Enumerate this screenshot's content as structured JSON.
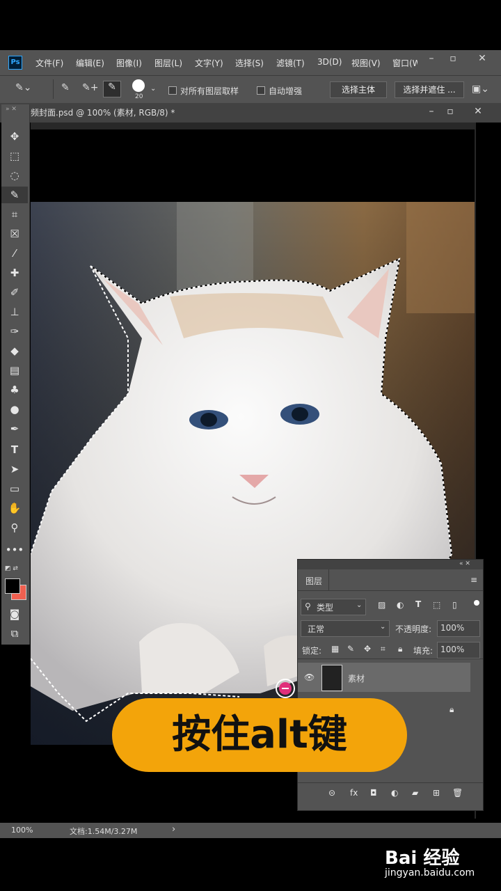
{
  "app": {
    "logo": "Ps"
  },
  "menu": [
    "文件(F)",
    "编辑(E)",
    "图像(I)",
    "图层(L)",
    "文字(Y)",
    "选择(S)",
    "滤镜(T)",
    "3D(D)",
    "视图(V)",
    "窗口(W"
  ],
  "options": {
    "brush_size": "20",
    "sample_all_layers": "对所有图层取样",
    "auto_enhance": "自动增强",
    "select_subject": "选择主体",
    "select_and_mask": "选择并遮住 ..."
  },
  "document": {
    "tab_title": "频封面.psd @ 100% (素材, RGB/8) *"
  },
  "status": {
    "zoom": "100%",
    "doc_size": "文档:1.54M/3.27M",
    "arrow": "›"
  },
  "layers_panel": {
    "title": "图层",
    "filter_kind": "类型",
    "blend_mode": "正常",
    "opacity_label": "不透明度:",
    "opacity_value": "100%",
    "lock_label": "锁定:",
    "fill_label": "填充:",
    "fill_value": "100%",
    "layers": [
      {
        "name": "素材",
        "visible": true
      },
      {
        "name": "",
        "locked": true
      }
    ]
  },
  "caption": "按住alt键",
  "watermark": {
    "logo": "Bai 经验",
    "url": "jingyan.baidu.com"
  },
  "colors": {
    "accent": "#f3a40a",
    "panel": "#535353",
    "fg_swatch": "#000000",
    "bg_swatch": "#f06050"
  }
}
